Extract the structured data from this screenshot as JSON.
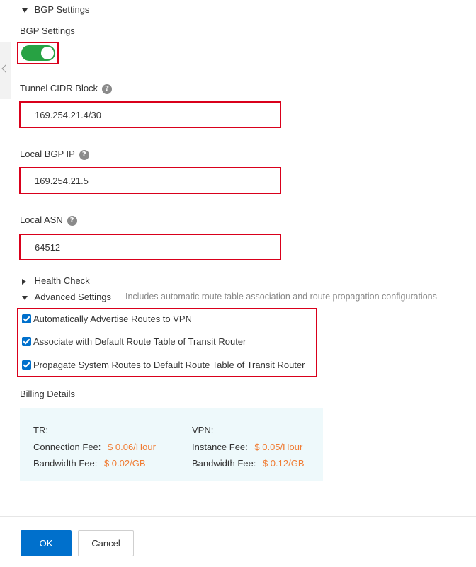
{
  "bgp_section": {
    "header": "BGP Settings",
    "label": "BGP Settings",
    "enabled": true
  },
  "fields": {
    "tunnel_cidr": {
      "label": "Tunnel CIDR Block",
      "value": "169.254.21.4/30"
    },
    "local_bgp_ip": {
      "label": "Local BGP IP",
      "value": "169.254.21.5"
    },
    "local_asn": {
      "label": "Local ASN",
      "value": "64512"
    }
  },
  "help_glyph": "?",
  "health_check": {
    "label": "Health Check"
  },
  "advanced": {
    "label": "Advanced Settings",
    "description": "Includes automatic route table association and route propagation configurations",
    "options": [
      {
        "label": "Automatically Advertise Routes to VPN",
        "checked": true
      },
      {
        "label": "Associate with Default Route Table of Transit Router",
        "checked": true
      },
      {
        "label": "Propagate System Routes to Default Route Table of Transit Router",
        "checked": true
      }
    ]
  },
  "billing": {
    "title": "Billing Details",
    "tr": {
      "heading": "TR:",
      "connection_fee_label": "Connection Fee:",
      "connection_fee": "$ 0.06/Hour",
      "bandwidth_fee_label": "Bandwidth Fee:",
      "bandwidth_fee": "$ 0.02/GB"
    },
    "vpn": {
      "heading": "VPN:",
      "instance_fee_label": "Instance Fee:",
      "instance_fee": "$ 0.05/Hour",
      "bandwidth_fee_label": "Bandwidth Fee:",
      "bandwidth_fee": "$ 0.12/GB"
    }
  },
  "footer": {
    "ok_label": "OK",
    "cancel_label": "Cancel"
  },
  "colors": {
    "accent": "#0070cc",
    "toggle_on": "#27a243",
    "highlight_border": "#d9001b",
    "fee_text": "#f07c33",
    "billing_bg": "#eef9fb"
  },
  "icons": {
    "collapse_panel": "chevron-left-icon",
    "expanded": "caret-down-icon",
    "collapsed": "caret-right-icon",
    "help": "question-circle-icon",
    "checkbox": "checkbox-checked-icon"
  }
}
